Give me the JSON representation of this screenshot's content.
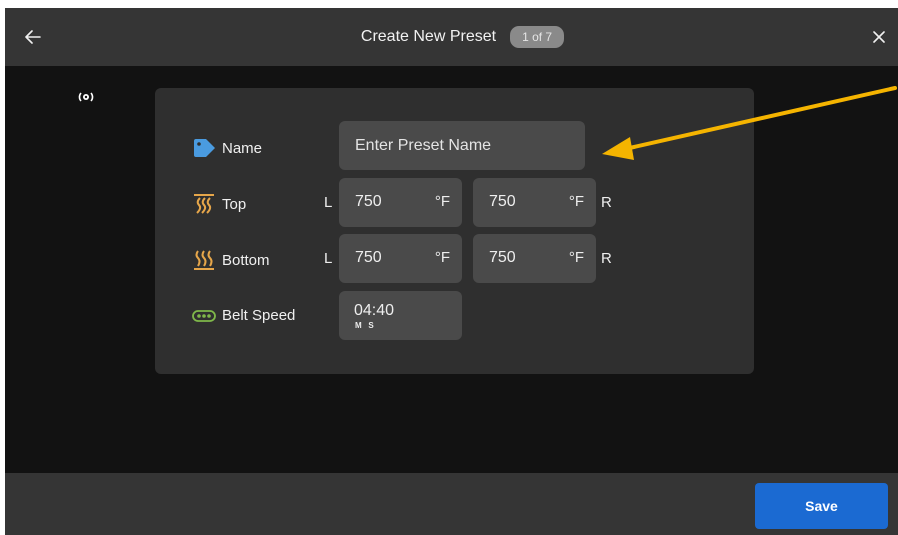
{
  "header": {
    "title": "Create New Preset",
    "step": "1 of 7",
    "back_icon": "arrow-left-icon",
    "close_icon": "close-icon"
  },
  "status_icon": "connectivity-icon",
  "form": {
    "name": {
      "label": "Name",
      "icon": "tag-icon",
      "placeholder": "Enter Preset Name",
      "value": ""
    },
    "top": {
      "label": "Top",
      "icon": "top-heat-icon",
      "left_marker": "L",
      "right_marker": "R",
      "left_value": "750",
      "right_value": "750",
      "unit": "°F"
    },
    "bottom": {
      "label": "Bottom",
      "icon": "bottom-heat-icon",
      "left_marker": "L",
      "right_marker": "R",
      "left_value": "750",
      "right_value": "750",
      "unit": "°F"
    },
    "belt_speed": {
      "label": "Belt Speed",
      "icon": "conveyor-belt-icon",
      "value": "04:40",
      "minutes_label": "M",
      "seconds_label": "S"
    }
  },
  "footer": {
    "save_label": "Save"
  },
  "colors": {
    "header_bg": "#353535",
    "screen_bg": "#121212",
    "panel_bg": "#2f2f2f",
    "field_bg": "#4a4a4a",
    "accent_blue": "#1b6ad2",
    "tag_blue": "#4a9be0",
    "heat_orange": "#e6a64a",
    "belt_green": "#7fb84a",
    "callout_arrow": "#f5b400"
  }
}
